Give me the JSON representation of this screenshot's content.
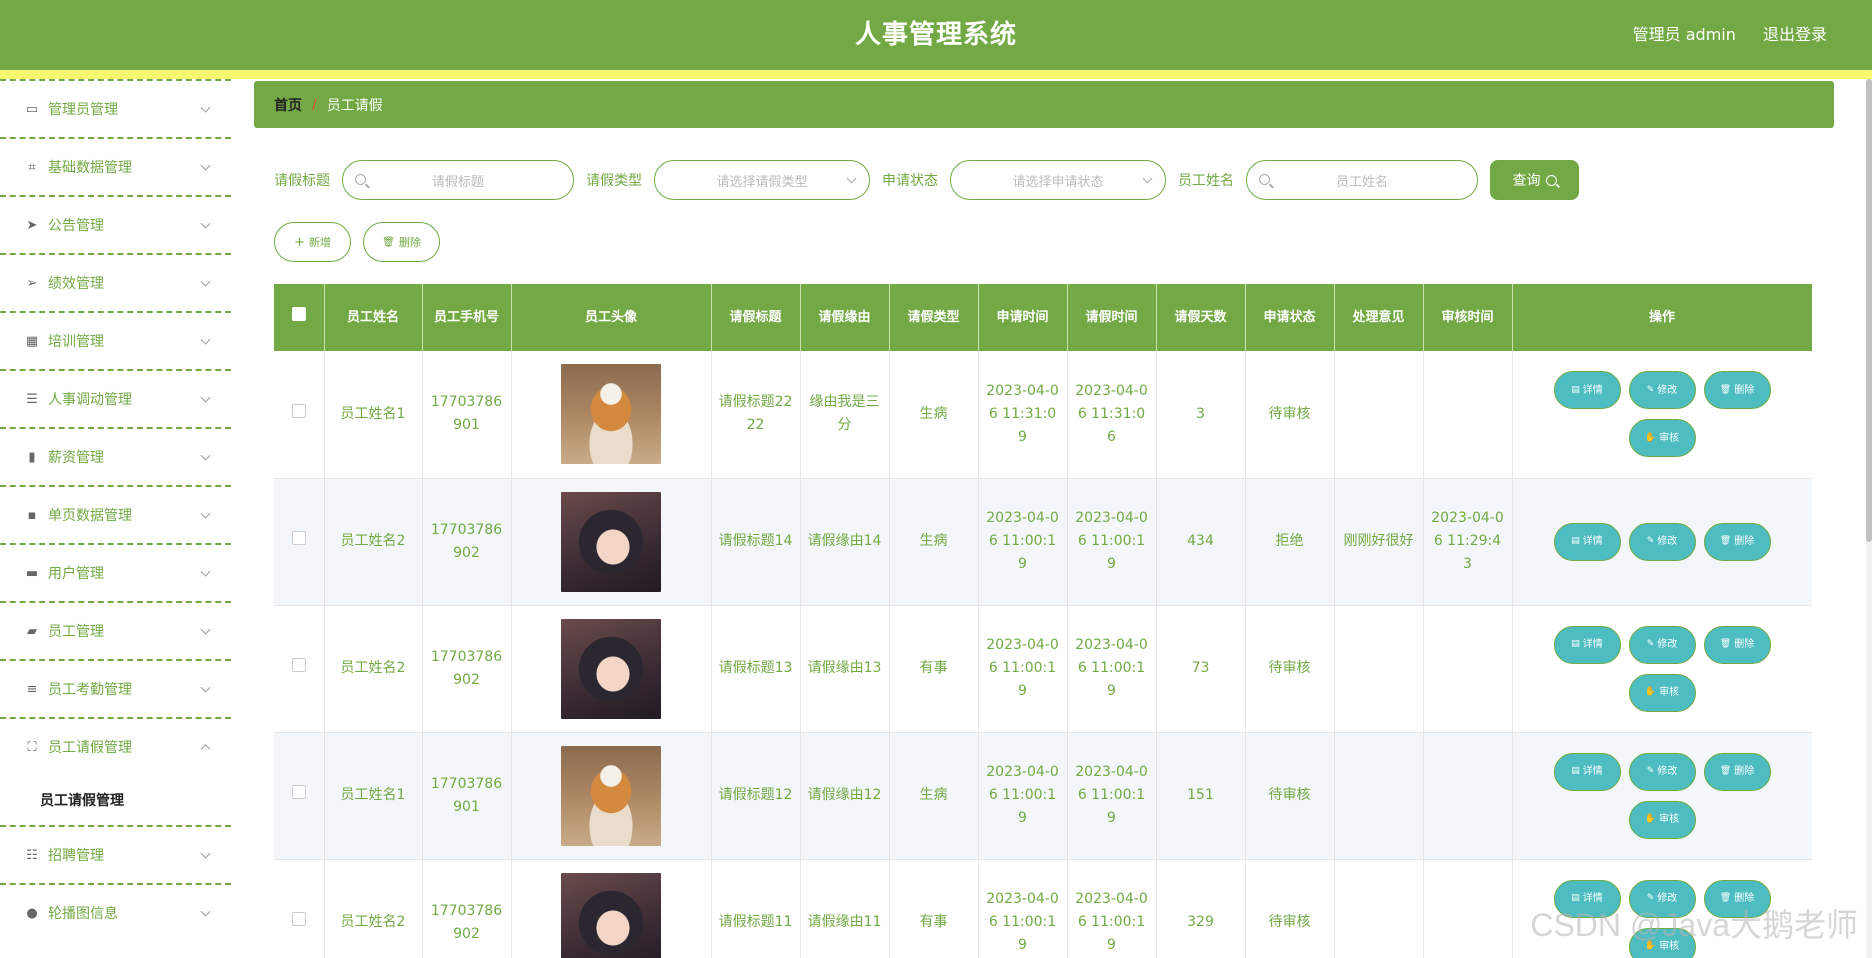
{
  "header": {
    "title": "人事管理系统",
    "user_label": "管理员 admin",
    "logout_label": "退出登录"
  },
  "sidebar": {
    "items": [
      {
        "label": "管理员管理",
        "icon": "card-icon"
      },
      {
        "label": "基础数据管理",
        "icon": "crop-icon"
      },
      {
        "label": "公告管理",
        "icon": "send-icon"
      },
      {
        "label": "绩效管理",
        "icon": "navigation-icon"
      },
      {
        "label": "培训管理",
        "icon": "grid-icon"
      },
      {
        "label": "人事调动管理",
        "icon": "sliders-icon"
      },
      {
        "label": "薪资管理",
        "icon": "bars-icon"
      },
      {
        "label": "单页数据管理",
        "icon": "chat-icon"
      },
      {
        "label": "用户管理",
        "icon": "printer-icon"
      },
      {
        "label": "员工管理",
        "icon": "wallet-icon"
      },
      {
        "label": "员工考勤管理",
        "icon": "list-icon"
      },
      {
        "label": "员工请假管理",
        "icon": "fullscreen-icon"
      },
      {
        "label": "招聘管理",
        "icon": "menu-icon"
      },
      {
        "label": "轮播图信息",
        "icon": "user-icon"
      }
    ],
    "open_submenu": "员工请假管理"
  },
  "breadcrumb": {
    "home": "首页",
    "current": "员工请假"
  },
  "search": {
    "title_label": "请假标题",
    "title_placeholder": "请假标题",
    "type_label": "请假类型",
    "type_placeholder": "请选择请假类型",
    "status_label": "申请状态",
    "status_placeholder": "请选择申请状态",
    "name_label": "员工姓名",
    "name_placeholder": "员工姓名",
    "query_label": "查询"
  },
  "actions": {
    "add_label": "新增",
    "delete_label": "删除"
  },
  "table": {
    "headers": [
      "员工姓名",
      "员工手机号",
      "员工头像",
      "请假标题",
      "请假缘由",
      "请假类型",
      "申请时间",
      "请假时间",
      "请假天数",
      "申请状态",
      "处理意见",
      "审核时间",
      "操作"
    ],
    "op_labels": {
      "detail": "详情",
      "edit": "修改",
      "delete": "删除",
      "audit": "审核"
    },
    "rows": [
      {
        "name": "员工姓名1",
        "phone": "17703786901",
        "avatar": "dog",
        "title": "请假标题2222",
        "reason": "缘由我是三分",
        "type": "生病",
        "apply_time": "2023-04-06 11:31:09",
        "leave_time": "2023-04-06 11:31:06",
        "days": "3",
        "status": "待审核",
        "opinion": "",
        "audit_time": "",
        "auditable": true
      },
      {
        "name": "员工姓名2",
        "phone": "17703786902",
        "avatar": "girl",
        "title": "请假标题14",
        "reason": "请假缘由14",
        "type": "生病",
        "apply_time": "2023-04-06 11:00:19",
        "leave_time": "2023-04-06 11:00:19",
        "days": "434",
        "status": "拒绝",
        "opinion": "刚刚好很好",
        "audit_time": "2023-04-06 11:29:43",
        "auditable": false
      },
      {
        "name": "员工姓名2",
        "phone": "17703786902",
        "avatar": "girl",
        "title": "请假标题13",
        "reason": "请假缘由13",
        "type": "有事",
        "apply_time": "2023-04-06 11:00:19",
        "leave_time": "2023-04-06 11:00:19",
        "days": "73",
        "status": "待审核",
        "opinion": "",
        "audit_time": "",
        "auditable": true
      },
      {
        "name": "员工姓名1",
        "phone": "17703786901",
        "avatar": "dog",
        "title": "请假标题12",
        "reason": "请假缘由12",
        "type": "生病",
        "apply_time": "2023-04-06 11:00:19",
        "leave_time": "2023-04-06 11:00:19",
        "days": "151",
        "status": "待审核",
        "opinion": "",
        "audit_time": "",
        "auditable": true
      },
      {
        "name": "员工姓名2",
        "phone": "17703786902",
        "avatar": "girl",
        "title": "请假标题11",
        "reason": "请假缘由11",
        "type": "有事",
        "apply_time": "2023-04-06 11:00:19",
        "leave_time": "2023-04-06 11:00:19",
        "days": "329",
        "status": "待审核",
        "opinion": "",
        "audit_time": "",
        "auditable": true
      }
    ]
  },
  "watermark": "CSDN @Java大鹅老师",
  "colors": {
    "primary": "#72a944",
    "stripe": "#f7f870",
    "op_button": "#4ebdc2",
    "accent": "#e8502e"
  }
}
